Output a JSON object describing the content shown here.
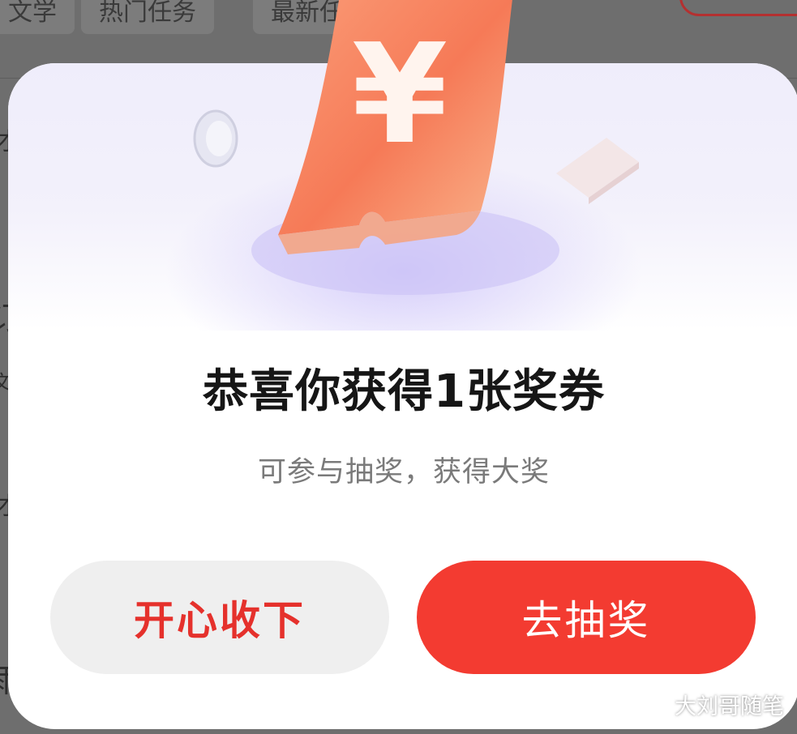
{
  "background": {
    "tabs": [
      "文学",
      "热门任务",
      "最新任务"
    ],
    "side_text": [
      "才",
      "订",
      "文",
      "才",
      "雨"
    ]
  },
  "modal": {
    "currency_symbol": "¥",
    "title": "恭喜你获得1张奖券",
    "subtitle": "可参与抽奖，获得大奖",
    "accept_button": "开心收下",
    "draw_button": "去抽奖"
  },
  "watermark": {
    "text": "大刘哥随笔",
    "icon": "wechat-icon"
  },
  "colors": {
    "primary": "#f33b31",
    "accent_text": "#e5312c",
    "ticket": "#f7885f"
  }
}
